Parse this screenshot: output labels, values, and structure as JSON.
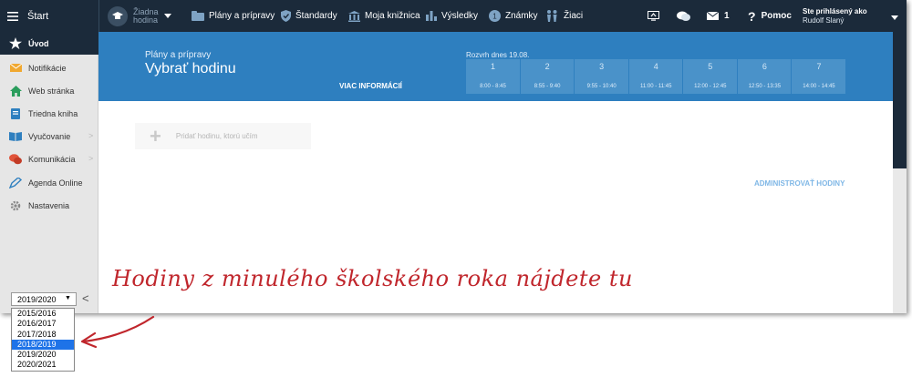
{
  "topbar": {
    "start_label": "Štart",
    "class_selector": {
      "line1": "Žiadna",
      "line2": "hodina"
    },
    "menu": [
      {
        "label": "Plány a prípravy",
        "icon": "folder-icon"
      },
      {
        "label": "Štandardy",
        "icon": "shield-icon"
      },
      {
        "label": "Moja knižnica",
        "icon": "library-icon"
      },
      {
        "label": "Výsledky",
        "icon": "bar-chart-icon"
      },
      {
        "label": "Známky",
        "icon": "grade-icon"
      },
      {
        "label": "Žiaci",
        "icon": "students-icon"
      }
    ],
    "mail_count": "1",
    "help_label": "Pomoc",
    "help_mark": "?",
    "user": {
      "prefix": "Ste prihlásený ako",
      "name": "Rudolf Slaný"
    }
  },
  "sidebar": {
    "items": [
      {
        "label": "Úvod"
      },
      {
        "label": "Notifikácie"
      },
      {
        "label": "Web stránka"
      },
      {
        "label": "Triedna kniha"
      },
      {
        "label": "Vyučovanie",
        "chevron": ">"
      },
      {
        "label": "Komunikácia",
        "chevron": ">"
      },
      {
        "label": "Agenda Online"
      },
      {
        "label": "Nastavenia"
      }
    ],
    "year_selected": "2019/2020",
    "collapse_glyph": "<"
  },
  "main": {
    "breadcrumb": "Plány a prípravy",
    "title": "Vybrať hodinu",
    "more_info": "VIAC INFORMÁCIÍ",
    "schedule_label": "Rozvrh dnes 19.08.",
    "periods": [
      {
        "num": "1",
        "time": "8:00 - 8:45"
      },
      {
        "num": "2",
        "time": "8:55 - 9:40"
      },
      {
        "num": "3",
        "time": "9:55 - 10:40"
      },
      {
        "num": "4",
        "time": "11:00 - 11:45"
      },
      {
        "num": "5",
        "time": "12:00 - 12:45"
      },
      {
        "num": "6",
        "time": "12:50 - 13:35"
      },
      {
        "num": "7",
        "time": "14:00 - 14:45"
      }
    ],
    "add_lesson": "Pridať hodinu, ktorú učím",
    "admin_link": "ADMINISTROVAŤ HODINY"
  },
  "year_dropdown": {
    "options": [
      "2015/2016",
      "2016/2017",
      "2017/2018",
      "2018/2019",
      "2019/2020",
      "2020/2021"
    ],
    "highlighted": "2018/2019"
  },
  "annotation": "Hodiny z minulého školského roka nájdete tu",
  "colors": {
    "header": "#1b2a3a",
    "blue_banner": "#2e7fbf",
    "annotation": "#c0262c",
    "highlight": "#1e73e8"
  }
}
